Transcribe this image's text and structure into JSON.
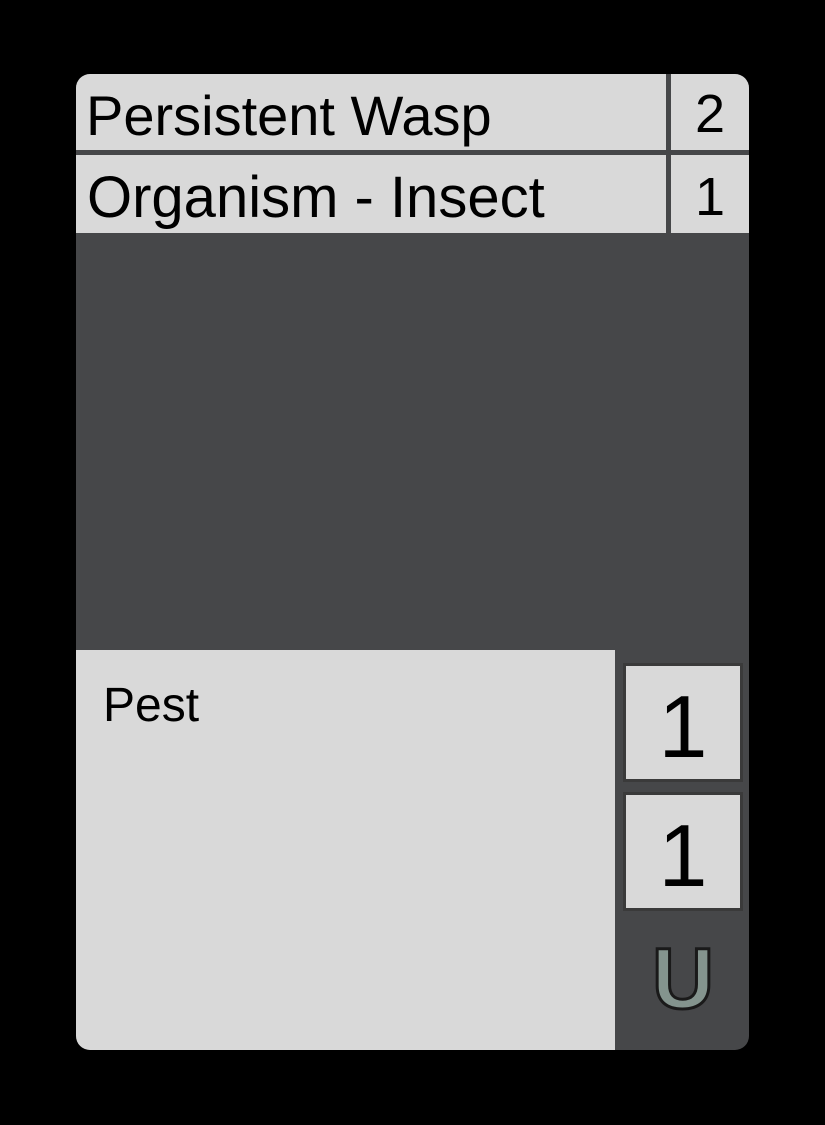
{
  "card": {
    "name": "Persistent Wasp",
    "cost": "2",
    "type_line": "Organism - Insect",
    "level": "1",
    "ability_text": "Pest",
    "attack": "1",
    "health": "1",
    "rarity_symbol": "U"
  },
  "colors": {
    "background": "#000000",
    "card_frame": "#464749",
    "panel": "#d9d9d9",
    "rarity": "#84948e"
  }
}
